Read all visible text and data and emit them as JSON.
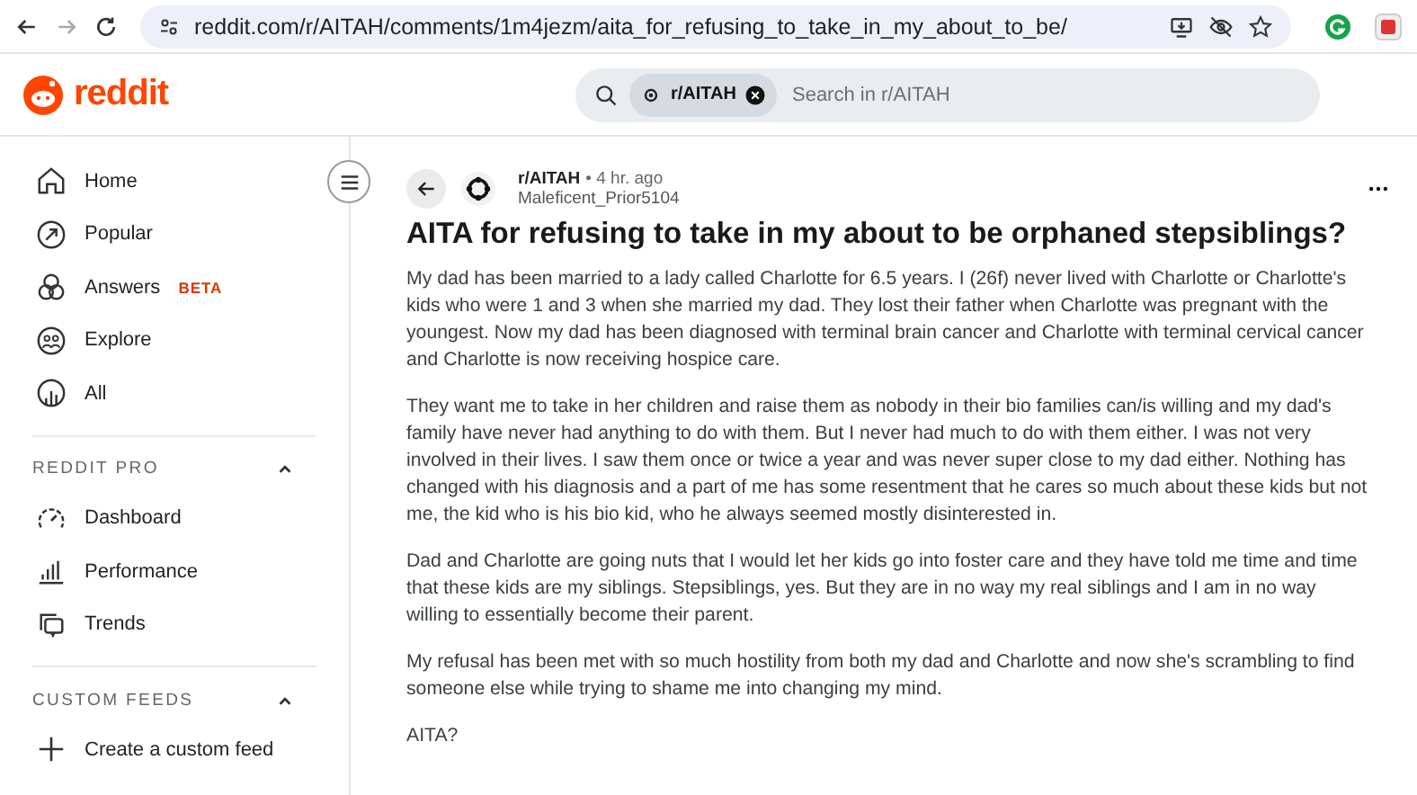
{
  "browser": {
    "url": "reddit.com/r/AITAH/comments/1m4jezm/aita_for_refusing_to_take_in_my_about_to_be/",
    "forward_disabled": true
  },
  "header": {
    "logo": "reddit",
    "search": {
      "chip": "r/AITAH",
      "placeholder": "Search in r/AITAH"
    }
  },
  "sidebar": {
    "items": [
      {
        "label": "Home"
      },
      {
        "label": "Popular"
      },
      {
        "label": "Answers",
        "badge": "BETA"
      },
      {
        "label": "Explore"
      },
      {
        "label": "All"
      }
    ],
    "sections": [
      {
        "title": "REDDIT PRO",
        "expanded": true,
        "items": [
          {
            "label": "Dashboard"
          },
          {
            "label": "Performance"
          },
          {
            "label": "Trends"
          }
        ]
      },
      {
        "title": "CUSTOM FEEDS",
        "expanded": true,
        "items": [
          {
            "label": "Create a custom feed"
          }
        ]
      }
    ]
  },
  "post": {
    "subreddit": "r/AITAH",
    "time": "• 4 hr. ago",
    "author": "Maleficent_Prior5104",
    "title": "AITA for refusing to take in my about to be orphaned stepsiblings?",
    "paragraphs": [
      "My dad has been married to a lady called Charlotte for 6.5 years. I (26f) never lived with Charlotte or Charlotte's kids who were 1 and 3 when she married my dad. They lost their father when Charlotte was pregnant with the youngest. Now my dad has been diagnosed with terminal brain cancer and Charlotte with terminal cervical cancer and Charlotte is now receiving hospice care.",
      "They want me to take in her children and raise them as nobody in their bio families can/is willing and my dad's family have never had anything to do with them. But I never had much to do with them either. I was not very involved in their lives. I saw them once or twice a year and was never super close to my dad either. Nothing has changed with his diagnosis and a part of me has some resentment that he cares so much about these kids but not me, the kid who is his bio kid, who he always seemed mostly disinterested in.",
      "Dad and Charlotte are going nuts that I would let her kids go into foster care and they have told me time and time that these kids are my siblings. Stepsiblings, yes. But they are in no way my real siblings and I am in no way willing to essentially become their parent.",
      "My refusal has been met with so much hostility from both my dad and Charlotte and now she's scrambling to find someone else while trying to shame me into changing my mind.",
      "AITA?"
    ]
  }
}
